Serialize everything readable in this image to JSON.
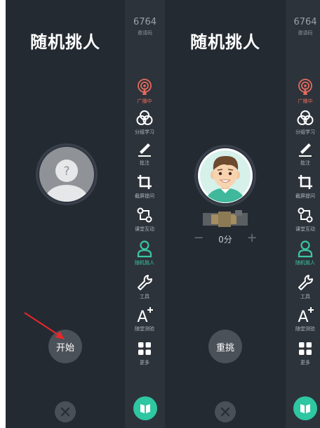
{
  "left_panel": {
    "title": "随机挑人",
    "start_button": "开始"
  },
  "right_panel": {
    "title": "随机挑人",
    "score": "0分",
    "score_minus": "−",
    "score_plus": "+",
    "reselect_button": "重挑"
  },
  "sidebar": {
    "invite_code": "6764",
    "invite_label": "邀请码",
    "tools": [
      {
        "label": "广播中",
        "icon": "broadcast-icon"
      },
      {
        "label": "分组学习",
        "icon": "group-icon"
      },
      {
        "label": "批注",
        "icon": "pen-icon"
      },
      {
        "label": "截屏提问",
        "icon": "crop-icon"
      },
      {
        "label": "课堂互动",
        "icon": "interaction-icon"
      },
      {
        "label": "随机挑人",
        "icon": "person-icon"
      },
      {
        "label": "工具",
        "icon": "wrench-icon"
      },
      {
        "label": "随堂测验",
        "icon": "quiz-icon"
      },
      {
        "label": "更多",
        "icon": "grid-icon"
      }
    ]
  },
  "colors": {
    "panel_bg": "#242a31",
    "sidebar_bg": "#2d333b",
    "accent_green": "#3cc6a3",
    "live_red": "#e56b5d",
    "annotation_arrow": "#e8272a"
  }
}
